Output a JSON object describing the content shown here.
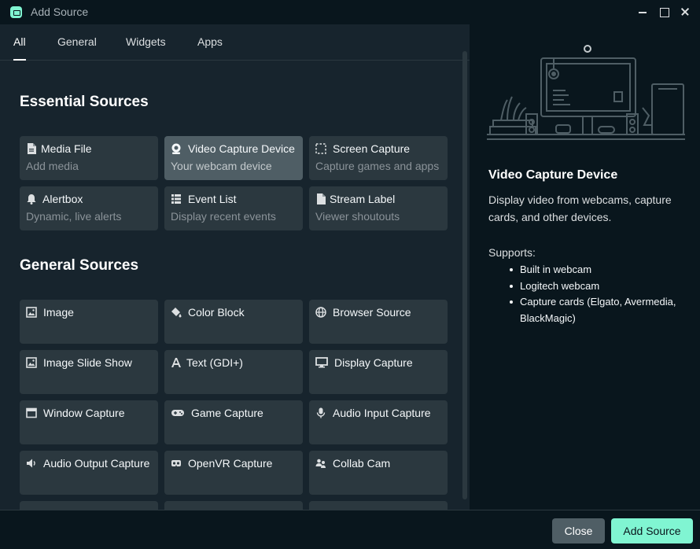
{
  "window": {
    "title": "Add Source"
  },
  "tabs": [
    {
      "label": "All",
      "active": true
    },
    {
      "label": "General",
      "active": false
    },
    {
      "label": "Widgets",
      "active": false
    },
    {
      "label": "Apps",
      "active": false
    }
  ],
  "sections": {
    "essential": {
      "title": "Essential Sources"
    },
    "general": {
      "title": "General Sources"
    }
  },
  "essential_sources": [
    {
      "icon": "file-icon",
      "name": "Media File",
      "desc": "Add media"
    },
    {
      "icon": "webcam-icon",
      "name": "Video Capture Device",
      "desc": "Your webcam device",
      "selected": true
    },
    {
      "icon": "screen-select-icon",
      "name": "Screen Capture",
      "desc": "Capture games and apps"
    },
    {
      "icon": "bell-icon",
      "name": "Alertbox",
      "desc": "Dynamic, live alerts"
    },
    {
      "icon": "list-icon",
      "name": "Event List",
      "desc": "Display recent events"
    },
    {
      "icon": "document-icon",
      "name": "Stream Label",
      "desc": "Viewer shoutouts"
    }
  ],
  "general_sources": [
    {
      "icon": "image-icon",
      "name": "Image"
    },
    {
      "icon": "paint-bucket-icon",
      "name": "Color Block"
    },
    {
      "icon": "globe-icon",
      "name": "Browser Source"
    },
    {
      "icon": "image-icon",
      "name": "Image Slide Show"
    },
    {
      "icon": "text-icon",
      "name": "Text (GDI+)"
    },
    {
      "icon": "monitor-icon",
      "name": "Display Capture"
    },
    {
      "icon": "window-icon",
      "name": "Window Capture"
    },
    {
      "icon": "gamepad-icon",
      "name": "Game Capture"
    },
    {
      "icon": "microphone-icon",
      "name": "Audio Input Capture"
    },
    {
      "icon": "speaker-icon",
      "name": "Audio Output Capture"
    },
    {
      "icon": "vr-headset-icon",
      "name": "OpenVR Capture"
    },
    {
      "icon": "users-icon",
      "name": "Collab Cam"
    }
  ],
  "detail": {
    "title": "Video Capture Device",
    "description": "Display video from webcams, capture cards, and other devices.",
    "supports_label": "Supports:",
    "supports": [
      "Built in webcam",
      "Logitech webcam",
      "Capture cards (Elgato, Avermedia, BlackMagic)"
    ]
  },
  "footer": {
    "close_label": "Close",
    "add_label": "Add Source"
  },
  "colors": {
    "accent": "#80f5d2",
    "card_bg": "#2b383f",
    "card_selected_bg": "#4f5e65",
    "panel_bg": "#09161d"
  }
}
